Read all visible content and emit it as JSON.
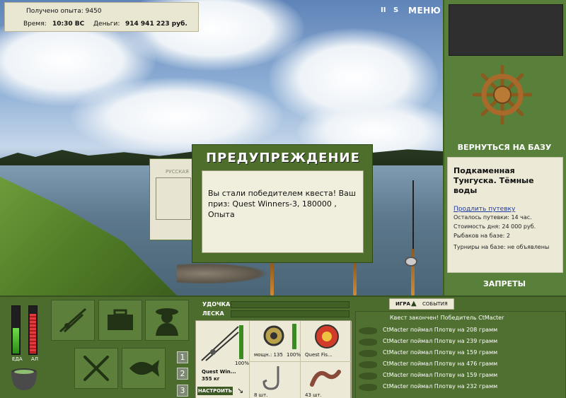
{
  "stats": {
    "exp_label": "Получено опыта: 9450",
    "time_label": "Время:",
    "time_value": "10:30 ВС",
    "money_label": "Деньги:",
    "money_value": "914 941 223 руб."
  },
  "top_icons": {
    "pause": "II",
    "sound": "S",
    "menu": "МЕНЮ"
  },
  "right": {
    "return_button": "ВЕРНУТЬСЯ НА БАЗУ",
    "location": "Подкаменная Тунгуска. Тёмные воды",
    "extend_link": "Продлить путевку",
    "trip_left": "Осталось путевки: 14 час.",
    "day_cost": "Стоимость дня: 24 000 руб.",
    "fishers": "Рыбаков на базе: 2",
    "tournaments": "Турниры на базе: не объявлены",
    "bans_button": "ЗАПРЕТЫ"
  },
  "bars": {
    "food": "ЕДА",
    "alcohol": "АЛ",
    "food_level": 0.55,
    "alcohol_level": 0.85
  },
  "slots": [
    "rods-icon",
    "tackle-box-icon",
    "fisherman-icon",
    "cutlery-icon",
    "fish-icon"
  ],
  "pages": [
    "1",
    "2",
    "3"
  ],
  "tackle": {
    "rod_label": "УДОЧКА",
    "line_label": "ЛЕСКА",
    "rod_name": "Quest Win...",
    "rod_weight": "355 кг",
    "rod_pct": "100%",
    "setup_button": "НАСТРОИТЬ",
    "reel_power": "мощн.: 135",
    "reel_pct": "100%",
    "line_name": "Quest Fis...",
    "hook_count": "8 шт.",
    "bait_count": "43 шт."
  },
  "events": {
    "tab_game": "ИГРА",
    "tab_events": "СОБЫТИЯ",
    "header": "Квест закончен! Победитель CtMacter",
    "rows": [
      "CtMacter поймал Плотву на 208 грамм",
      "CtMacter поймал Плотву на 239 грамм",
      "CtMacter поймал Плотву на 159 грамм",
      "CtMacter поймал Плотву на 476 грамм",
      "CtMacter поймал Плотву на 159 грамм",
      "CtMacter поймал Плотву на 232 грамм"
    ]
  },
  "dialog": {
    "back_tab": "РУССКАЯ",
    "title": "ПРЕДУПРЕЖДЕНИЕ",
    "message": "Вы стали победителем квеста! Ваш приз: Quest Winners-3, 180000 , Опыта"
  }
}
